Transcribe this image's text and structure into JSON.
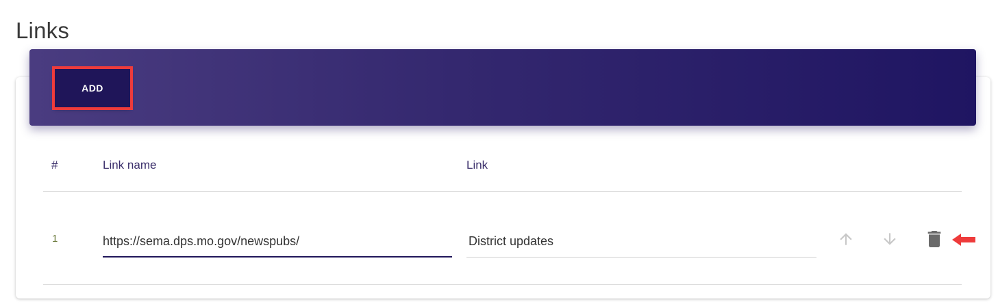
{
  "page": {
    "title": "Links"
  },
  "toolbar": {
    "add_label": "ADD"
  },
  "table": {
    "headers": {
      "index": "#",
      "link_name": "Link name",
      "link": "Link"
    },
    "rows": [
      {
        "index": "1",
        "link_name": "https://sema.dps.mo.gov/newspubs/",
        "link": "District updates"
      }
    ]
  },
  "icons": {
    "move_up": "arrow-up-icon",
    "move_down": "arrow-down-icon",
    "delete": "trash-icon",
    "annotation": "red-arrow-icon"
  },
  "colors": {
    "header_gradient_start": "#4a3c80",
    "header_gradient_end": "#1f1562",
    "add_button_bg": "#1f1559",
    "highlight": "#ee3b3b",
    "focus_underline": "#1f1559"
  }
}
